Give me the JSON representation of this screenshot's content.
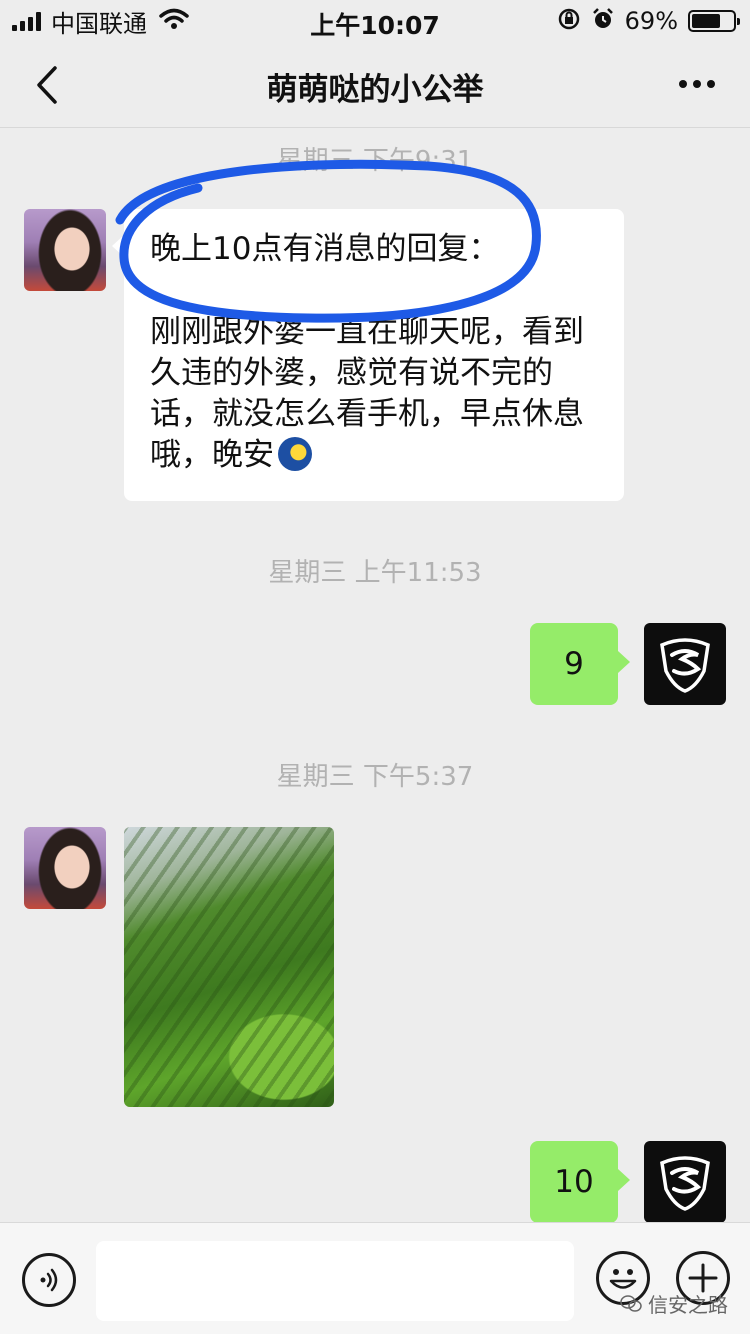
{
  "status_bar": {
    "carrier": "中国联通",
    "time": "上午10:07",
    "battery": "69%",
    "battery_level": 0.69
  },
  "nav": {
    "title": "萌萌哒的小公举",
    "back_icon": "chevron-left-icon",
    "more_icon": "more-dots-icon"
  },
  "messages": [
    {
      "type": "timestamp",
      "text": "星期三 下午9:31"
    },
    {
      "type": "text",
      "side": "left",
      "first_line": "晚上10点有消息的回复：",
      "body": "刚刚跟外婆一直在聊天呢，看到久违的外婆，感觉有说不完的话，就没怎么看手机，早点休息哦，晚安",
      "emoji": "moon-emoji"
    },
    {
      "type": "timestamp",
      "text": "星期三 上午11:53"
    },
    {
      "type": "text",
      "side": "right",
      "text": "9"
    },
    {
      "type": "timestamp",
      "text": "星期三 下午5:37"
    },
    {
      "type": "image",
      "side": "left",
      "description_icon": "tea-field-photo"
    },
    {
      "type": "text",
      "side": "right",
      "text": "10"
    }
  ],
  "input_bar": {
    "input_value": "",
    "voice_icon": "voice-icon",
    "emoji_icon": "emoji-icon",
    "plus_icon": "plus-icon",
    "watermark": "信安之路"
  },
  "colors": {
    "background": "#ededed",
    "outgoing_bubble": "#95ec69",
    "incoming_bubble": "#ffffff",
    "highlight_circle": "#1e5ae6",
    "timestamp": "#b2b2b2"
  }
}
